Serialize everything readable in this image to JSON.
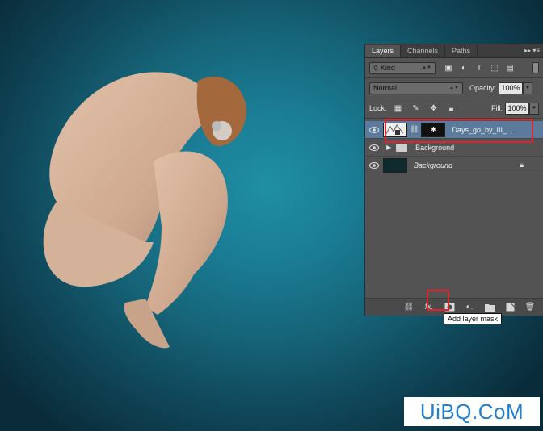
{
  "panel": {
    "tabs": [
      "Layers",
      "Channels",
      "Paths"
    ],
    "filter": {
      "label": "Kind"
    },
    "blend_mode": "Normal",
    "opacity_label": "Opacity:",
    "opacity_value": "100%",
    "lock_label": "Lock:",
    "fill_label": "Fill:",
    "fill_value": "100%",
    "layers": [
      {
        "name": "Days_go_by_III_...",
        "selected": true
      },
      {
        "name": "Background",
        "type": "group"
      },
      {
        "name": "Background",
        "italic": true,
        "locked": true
      }
    ]
  },
  "tooltip": "Add layer mask",
  "watermark": "UiBQ.CoM",
  "colors": {
    "highlight": "#e4222b",
    "selected_layer": "#5c7a9b",
    "watermark": "#1f7fd0"
  }
}
